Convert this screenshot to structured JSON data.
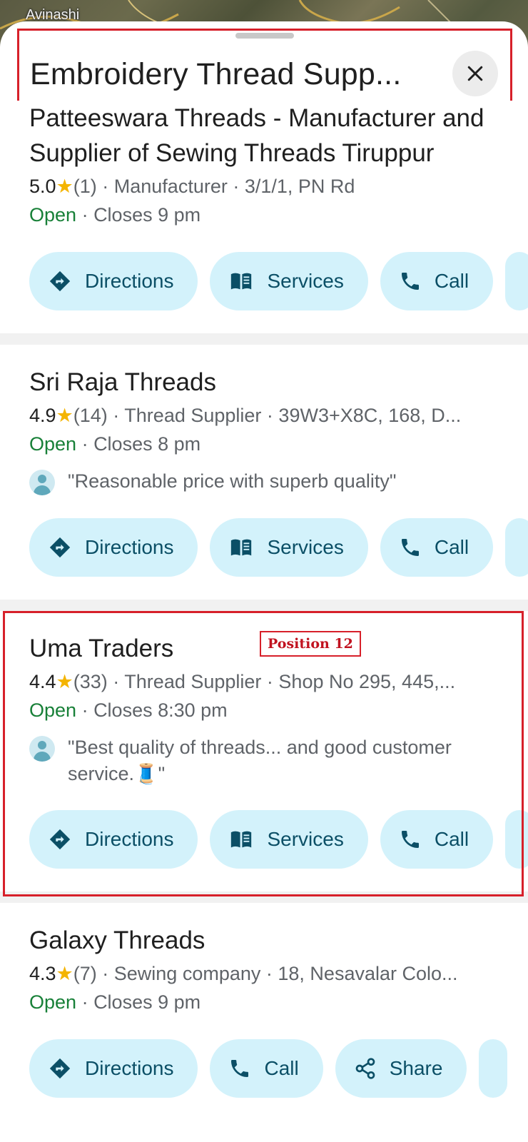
{
  "map": {
    "label": "Avinashi"
  },
  "header": {
    "title": "Embroidery Thread Supp...",
    "close_icon": "close-icon"
  },
  "colors": {
    "chip_bg": "#d3f2fb",
    "chip_text": "#0b4f66",
    "open_green": "#188038",
    "star": "#f4b400",
    "highlight_red": "#d7202a"
  },
  "listings": [
    {
      "name": "Patteeswara Threads - Manufacturer and Supplier of Sewing Threads Tiruppur",
      "rating": "5.0",
      "star": "★",
      "reviews": "(1)",
      "category": "Manufacturer",
      "address": "3/1/1, PN Rd",
      "status": "Open",
      "closes": "Closes 9 pm",
      "actions": [
        {
          "label": "Directions",
          "icon": "directions-icon"
        },
        {
          "label": "Services",
          "icon": "menu-book-icon"
        },
        {
          "label": "Call",
          "icon": "phone-icon"
        }
      ]
    },
    {
      "name": "Sri Raja Threads",
      "rating": "4.9",
      "star": "★",
      "reviews": "(14)",
      "category": "Thread Supplier",
      "address": "39W3+X8C, 168, D...",
      "status": "Open",
      "closes": "Closes 8 pm",
      "review": "\"Reasonable price with superb quality\"",
      "actions": [
        {
          "label": "Directions",
          "icon": "directions-icon"
        },
        {
          "label": "Services",
          "icon": "menu-book-icon"
        },
        {
          "label": "Call",
          "icon": "phone-icon"
        }
      ]
    },
    {
      "name": "Uma Traders",
      "position_tag": "Position 12",
      "rating": "4.4",
      "star": "★",
      "reviews": "(33)",
      "category": "Thread Supplier",
      "address": "Shop No 295, 445,...",
      "status": "Open",
      "closes": "Closes 8:30 pm",
      "review": "\"Best quality of threads... and good customer service.🧵\"",
      "actions": [
        {
          "label": "Directions",
          "icon": "directions-icon"
        },
        {
          "label": "Services",
          "icon": "menu-book-icon"
        },
        {
          "label": "Call",
          "icon": "phone-icon"
        }
      ]
    },
    {
      "name": "Galaxy Threads",
      "rating": "4.3",
      "star": "★",
      "reviews": "(7)",
      "category": "Sewing company",
      "address": "18, Nesavalar Colo...",
      "status": "Open",
      "closes": "Closes 9 pm",
      "actions": [
        {
          "label": "Directions",
          "icon": "directions-icon"
        },
        {
          "label": "Call",
          "icon": "phone-icon"
        },
        {
          "label": "Share",
          "icon": "share-icon"
        }
      ]
    }
  ]
}
